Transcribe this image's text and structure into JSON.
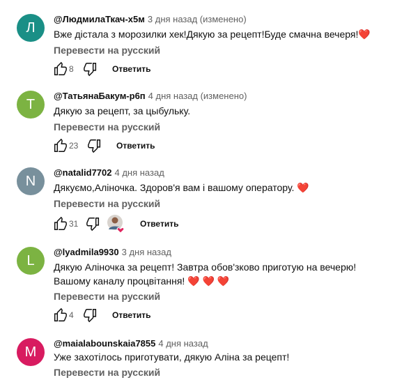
{
  "translate_label": "Перевести на русский",
  "reply_label": "Ответить",
  "colors": {
    "heart": "#e0245e"
  },
  "comments": [
    {
      "avatar_letter": "Л",
      "avatar_color": "#1a8f86",
      "author": "@ЛюдмилаТкач-х5м",
      "time": "3 дня назад (изменено)",
      "text": "Вже  дістала з морозилки  хек!Дякую за рецепт!Буде смачна вечеря!",
      "hearts": "❤️",
      "likes": "8"
    },
    {
      "avatar_letter": "T",
      "avatar_color": "#7cb342",
      "author": "@ТатьянаБакум-р6п",
      "time": "4 дня назад (изменено)",
      "text": "Дякую за рецепт, за цыбульку.",
      "hearts": "",
      "likes": "23"
    },
    {
      "avatar_letter": "N",
      "avatar_color": "#78909c",
      "author": "@natalid7702",
      "time": "4 дня назад",
      "text": "Дякуємо,Аліночка. Здоров'я вам і вашому оператору.",
      "hearts": "❤️",
      "likes": "31"
    },
    {
      "avatar_letter": "L",
      "avatar_color": "#7cb342",
      "author": "@lyadmila9930",
      "time": "3 дня назад",
      "text": "Дякую  Аліночка за рецепт! Завтра обов'зково приготую на вечерю! Вашому каналу процвітання!",
      "hearts": "❤️ ❤️ ❤️",
      "likes": "4"
    },
    {
      "avatar_letter": "M",
      "avatar_color": "#d81b60",
      "author": "@maialabounskaia7855",
      "time": "4 дня назад",
      "text": "Уже захотілось приготувати, дякую Аліна за рецепт!",
      "hearts": "",
      "likes": ""
    }
  ]
}
